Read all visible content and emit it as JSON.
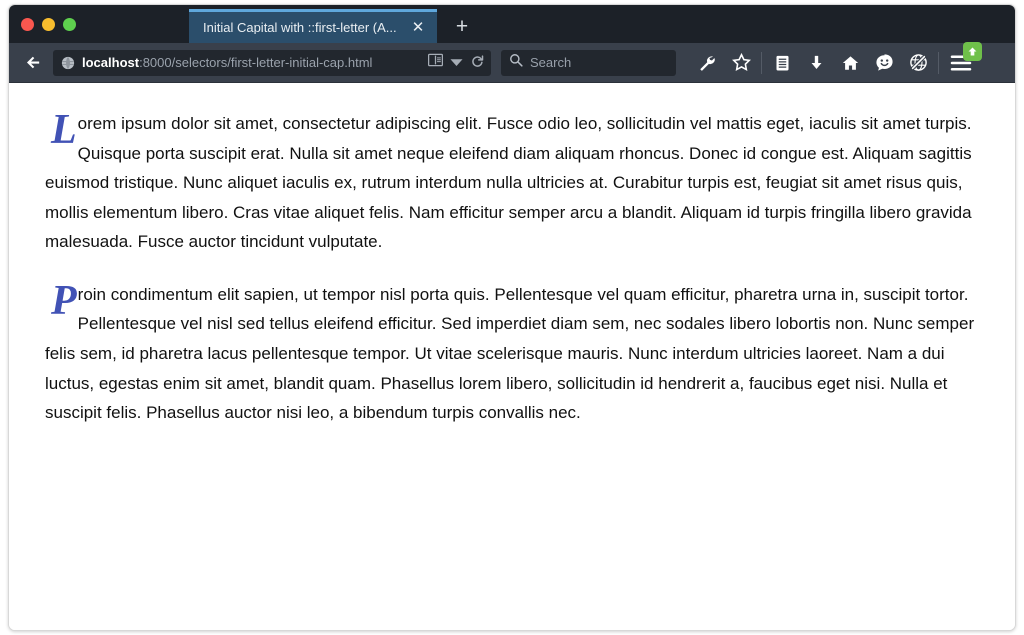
{
  "window": {
    "traffic_lights": [
      {
        "name": "close",
        "color": "#f9574f"
      },
      {
        "name": "minimize",
        "color": "#f7bd2e"
      },
      {
        "name": "zoom",
        "color": "#5ed04e"
      }
    ]
  },
  "tabs": {
    "active": {
      "title": "Initial Capital with ::first-letter (A...",
      "close_label": "✕"
    },
    "new_tab_label": "+"
  },
  "navbar": {
    "back_label": "←",
    "url": {
      "host": "localhost",
      "path": ":8000/selectors/first-letter-initial-cap.html",
      "favicon_name": "globe-favicon"
    },
    "url_actions": [
      {
        "name": "reader-mode-icon"
      },
      {
        "name": "chevron-down-icon"
      },
      {
        "name": "reload-icon"
      }
    ],
    "search": {
      "placeholder": "Search",
      "icon_name": "search-icon"
    },
    "toolbar_icons": [
      {
        "name": "wrench-icon"
      },
      {
        "name": "star-icon"
      },
      {
        "name": "reading-list-icon"
      },
      {
        "name": "download-icon"
      },
      {
        "name": "home-icon"
      },
      {
        "name": "smiley-icon"
      },
      {
        "name": "noscript-globe-icon"
      }
    ],
    "menu": {
      "name": "hamburger-menu-icon",
      "badge_name": "update-available-badge",
      "badge_color": "#6fc04a"
    }
  },
  "content": {
    "drop_cap_color": "#4152b5",
    "paragraphs": [
      {
        "initial": "L",
        "text": "orem ipsum dolor sit amet, consectetur adipiscing elit. Fusce odio leo, sollicitudin vel mattis eget, iaculis sit amet turpis. Quisque porta suscipit erat. Nulla sit amet neque eleifend diam aliquam rhoncus. Donec id congue est. Aliquam sagittis euismod tristique. Nunc aliquet iaculis ex, rutrum interdum nulla ultricies at. Curabitur turpis est, feugiat sit amet risus quis, mollis elementum libero. Cras vitae aliquet felis. Nam efficitur semper arcu a blandit. Aliquam id turpis fringilla libero gravida malesuada. Fusce auctor tincidunt vulputate."
      },
      {
        "initial": "P",
        "text": "roin condimentum elit sapien, ut tempor nisl porta quis. Pellentesque vel quam efficitur, pharetra urna in, suscipit tortor. Pellentesque vel nisl sed tellus eleifend efficitur. Sed imperdiet diam sem, nec sodales libero lobortis non. Nunc semper felis sem, id pharetra lacus pellentesque tempor. Ut vitae scelerisque mauris. Nunc interdum ultricies laoreet. Nam a dui luctus, egestas enim sit amet, blandit quam. Phasellus lorem libero, sollicitudin id hendrerit a, faucibus eget nisi. Nulla et suscipit felis. Phasellus auctor nisi leo, a bibendum turpis convallis nec."
      }
    ]
  }
}
